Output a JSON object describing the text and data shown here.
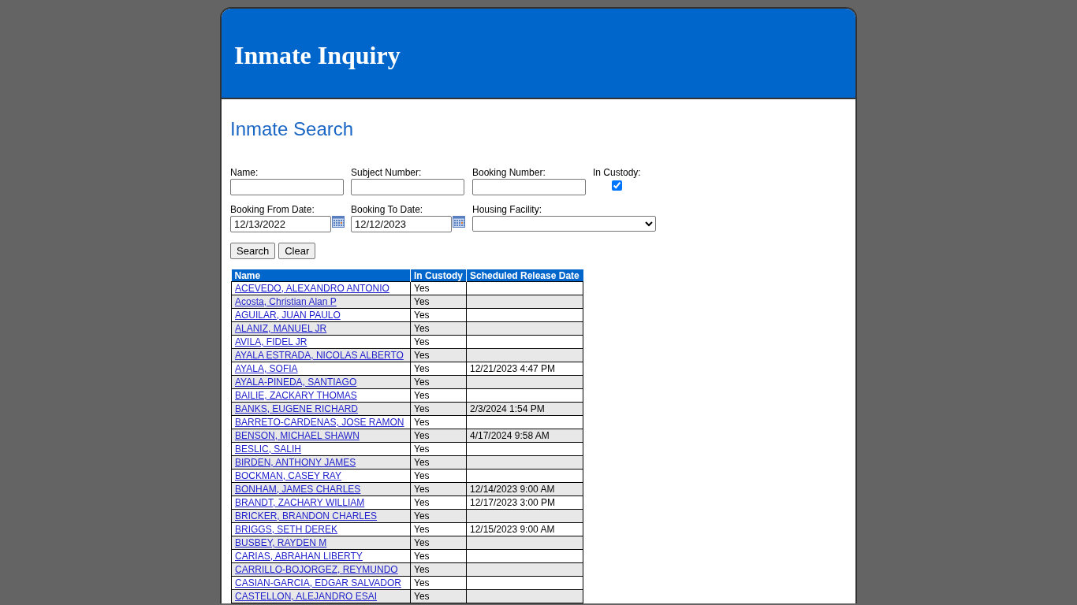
{
  "header": {
    "title": "Inmate Inquiry"
  },
  "search": {
    "heading": "Inmate Search",
    "fields": [
      {
        "kind": "text",
        "label": "Name:"
      },
      {
        "kind": "text",
        "label": "Subject Number:"
      },
      {
        "kind": "text",
        "label": "Booking Number:"
      },
      {
        "kind": "checkbox",
        "label": "In Custody:",
        "checked": true
      },
      {
        "kind": "date",
        "label": "Booking From Date:",
        "value": "12/13/2022"
      },
      {
        "kind": "date",
        "label": "Booking To Date:",
        "value": "12/12/2023"
      },
      {
        "kind": "select",
        "label": "Housing Facility:"
      }
    ],
    "buttons": [
      "Search",
      "Clear"
    ]
  },
  "table": {
    "columns": [
      "Name",
      "In Custody",
      "Scheduled Release Date"
    ],
    "rows": [
      {
        "name": "ACEVEDO, ALEXANDRO ANTONIO",
        "in_custody": "Yes"
      },
      {
        "name": "Acosta, Christian Alan P",
        "in_custody": "Yes"
      },
      {
        "name": "AGUILAR, JUAN PAULO",
        "in_custody": "Yes"
      },
      {
        "name": "ALANIZ, MANUEL JR",
        "in_custody": "Yes"
      },
      {
        "name": "AVILA, FIDEL JR",
        "in_custody": "Yes"
      },
      {
        "name": "AYALA ESTRADA, NICOLAS ALBERTO",
        "in_custody": "Yes"
      },
      {
        "name": "AYALA, SOFIA",
        "in_custody": "Yes",
        "release": "12/21/2023 4:47 PM"
      },
      {
        "name": "AYALA-PINEDA, SANTIAGO",
        "in_custody": "Yes"
      },
      {
        "name": "BAILIE, ZACKARY THOMAS",
        "in_custody": "Yes"
      },
      {
        "name": "BANKS, EUGENE RICHARD",
        "in_custody": "Yes",
        "release": "2/3/2024 1:54 PM"
      },
      {
        "name": "BARRETO-CARDENAS, JOSE RAMON",
        "in_custody": "Yes"
      },
      {
        "name": "BENSON, MICHAEL SHAWN",
        "in_custody": "Yes",
        "release": "4/17/2024 9:58 AM"
      },
      {
        "name": "BESLIC, SALIH",
        "in_custody": "Yes"
      },
      {
        "name": "BIRDEN, ANTHONY JAMES",
        "in_custody": "Yes"
      },
      {
        "name": "BOCKMAN, CASEY RAY",
        "in_custody": "Yes"
      },
      {
        "name": "BONHAM, JAMES CHARLES",
        "in_custody": "Yes",
        "release": "12/14/2023 9:00 AM"
      },
      {
        "name": "BRANDT, ZACHARY WILLIAM",
        "in_custody": "Yes",
        "release": "12/17/2023 3:00 PM"
      },
      {
        "name": "BRICKER, BRANDON CHARLES",
        "in_custody": "Yes"
      },
      {
        "name": "BRIGGS, SETH DEREK",
        "in_custody": "Yes",
        "release": "12/15/2023 9:00 AM"
      },
      {
        "name": "BUSBEY, RAYDEN M",
        "in_custody": "Yes"
      },
      {
        "name": "CARIAS, ABRAHAN LIBERTY",
        "in_custody": "Yes"
      },
      {
        "name": "CARRILLO-BOJORGEZ, REYMUNDO",
        "in_custody": "Yes"
      },
      {
        "name": "CASIAN-GARCIA, EDGAR SALVADOR",
        "in_custody": "Yes"
      },
      {
        "name": "CASTELLON, ALEJANDRO ESAI",
        "in_custody": "Yes"
      }
    ]
  }
}
